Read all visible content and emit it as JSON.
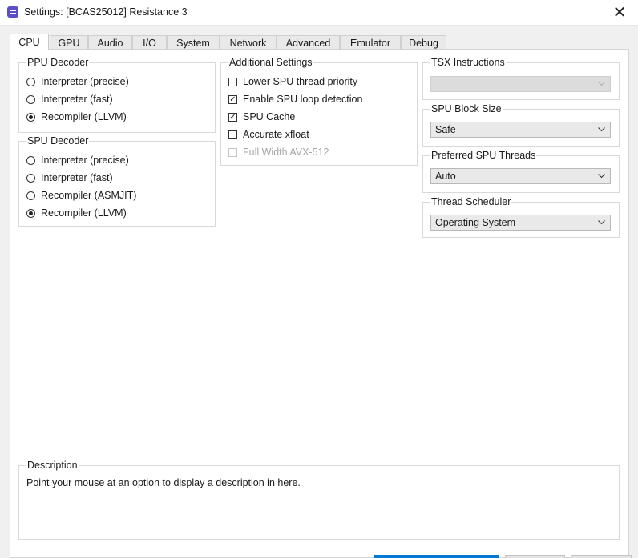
{
  "window": {
    "title": "Settings: [BCAS25012] Resistance 3",
    "close_glyph": "✕"
  },
  "tabs": [
    "CPU",
    "GPU",
    "Audio",
    "I/O",
    "System",
    "Network",
    "Advanced",
    "Emulator",
    "Debug"
  ],
  "active_tab": "CPU",
  "ppu_decoder": {
    "title": "PPU Decoder",
    "options": [
      "Interpreter (precise)",
      "Interpreter (fast)",
      "Recompiler (LLVM)"
    ],
    "selected": "Recompiler (LLVM)"
  },
  "spu_decoder": {
    "title": "SPU Decoder",
    "options": [
      "Interpreter (precise)",
      "Interpreter (fast)",
      "Recompiler (ASMJIT)",
      "Recompiler (LLVM)"
    ],
    "selected": "Recompiler (LLVM)"
  },
  "additional_settings": {
    "title": "Additional Settings",
    "options": [
      {
        "label": "Lower SPU thread priority",
        "checked": false,
        "enabled": true
      },
      {
        "label": "Enable SPU loop detection",
        "checked": true,
        "enabled": true
      },
      {
        "label": "SPU Cache",
        "checked": true,
        "enabled": true
      },
      {
        "label": "Accurate xfloat",
        "checked": false,
        "enabled": true
      },
      {
        "label": "Full Width AVX-512",
        "checked": false,
        "enabled": false
      }
    ]
  },
  "tsx_instructions": {
    "title": "TSX Instructions",
    "value": "",
    "enabled": false
  },
  "spu_block_size": {
    "title": "SPU Block Size",
    "value": "Safe"
  },
  "preferred_spu_threads": {
    "title": "Preferred SPU Threads",
    "value": "Auto"
  },
  "thread_scheduler": {
    "title": "Thread Scheduler",
    "value": "Operating System"
  },
  "description": {
    "title": "Description",
    "text": "Point your mouse at an option to display a description in here."
  },
  "icons": {
    "app": "rpcs3-app-icon",
    "close": "close-icon",
    "dropdown": "chevron-down-icon"
  },
  "colors": {
    "accent": "#0078d4",
    "app_icon": "#5b4fc9"
  }
}
